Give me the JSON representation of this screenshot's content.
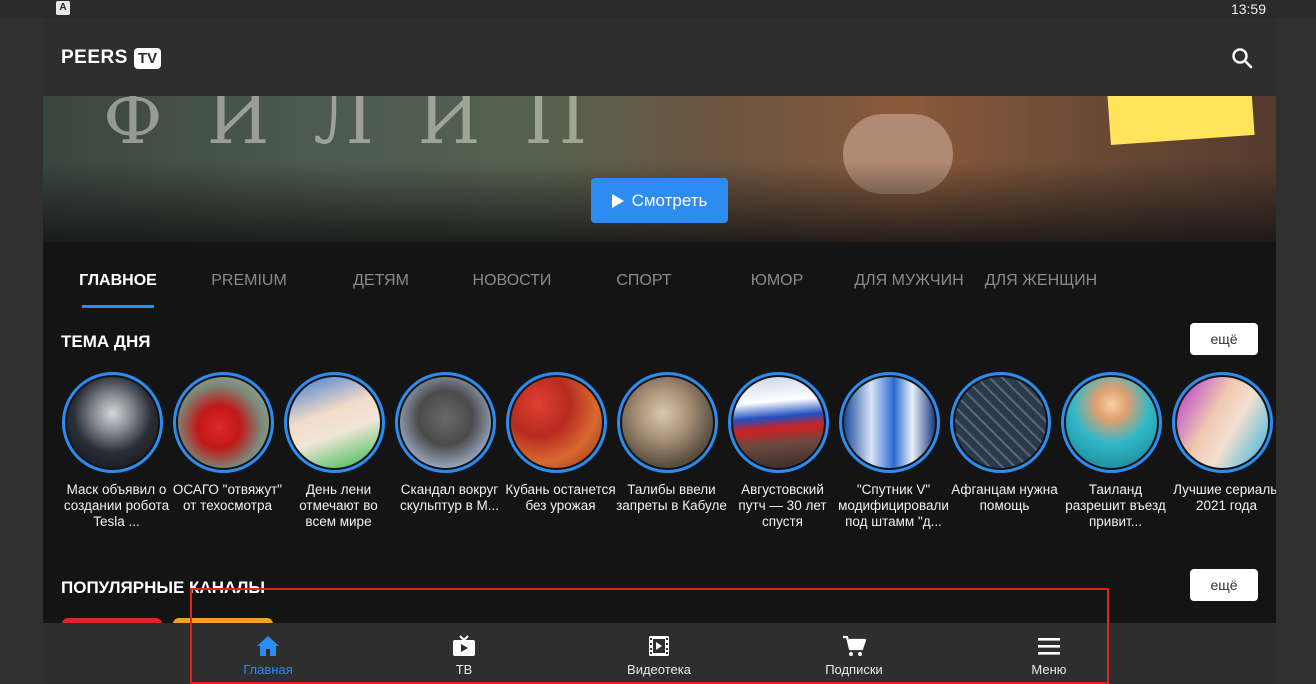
{
  "status_bar": {
    "time": "13:59",
    "app_icon_letter": "A"
  },
  "app_bar": {
    "logo_text": "PEERS",
    "logo_badge": "TV",
    "search_icon": "search-icon"
  },
  "banner": {
    "watch_label": "Смотреть"
  },
  "tabs": [
    {
      "label": "ГЛАВНОЕ",
      "active": true
    },
    {
      "label": "PREMIUM"
    },
    {
      "label": "ДЕТЯМ"
    },
    {
      "label": "НОВОСТИ"
    },
    {
      "label": "СПОРТ"
    },
    {
      "label": "ЮМОР"
    },
    {
      "label": "ДЛЯ МУЖЧИН"
    },
    {
      "label": "ДЛЯ ЖЕНЩИН"
    }
  ],
  "topic_of_day": {
    "title": "ТЕМА ДНЯ",
    "more_label": "ещё",
    "stories": [
      {
        "caption": "Маск объявил о создании робота Tesla ..."
      },
      {
        "caption": "ОСАГО \"отвяжут\" от техосмотра"
      },
      {
        "caption": "День лени отмечают во всем мире"
      },
      {
        "caption": "Скандал вокруг скульптур в М..."
      },
      {
        "caption": "Кубань останется без урожая"
      },
      {
        "caption": "Талибы ввели запреты в Кабуле"
      },
      {
        "caption": "Августовский путч — 30 лет спустя"
      },
      {
        "caption": "\"Спутник V\" модифицировали под штамм \"д..."
      },
      {
        "caption": "Афганцам нужна помощь"
      },
      {
        "caption": "Таиланд разрешит въезд привит..."
      },
      {
        "caption": "Лучшие сериалы 2021 года"
      }
    ]
  },
  "popular_channels": {
    "title": "ПОПУЛЯРНЫЕ КАНАЛЫ",
    "more_label": "ещё"
  },
  "bottom_nav": [
    {
      "label": "Главная",
      "icon": "home-icon",
      "active": true
    },
    {
      "label": "ТВ",
      "icon": "tv-icon"
    },
    {
      "label": "Видеотека",
      "icon": "film-icon"
    },
    {
      "label": "Подписки",
      "icon": "cart-icon"
    },
    {
      "label": "Меню",
      "icon": "menu-icon"
    }
  ],
  "colors": {
    "accent": "#2d8cf0",
    "appbar": "#2e2e2e",
    "background": "#141414",
    "annotation_box": "#e0241c"
  }
}
